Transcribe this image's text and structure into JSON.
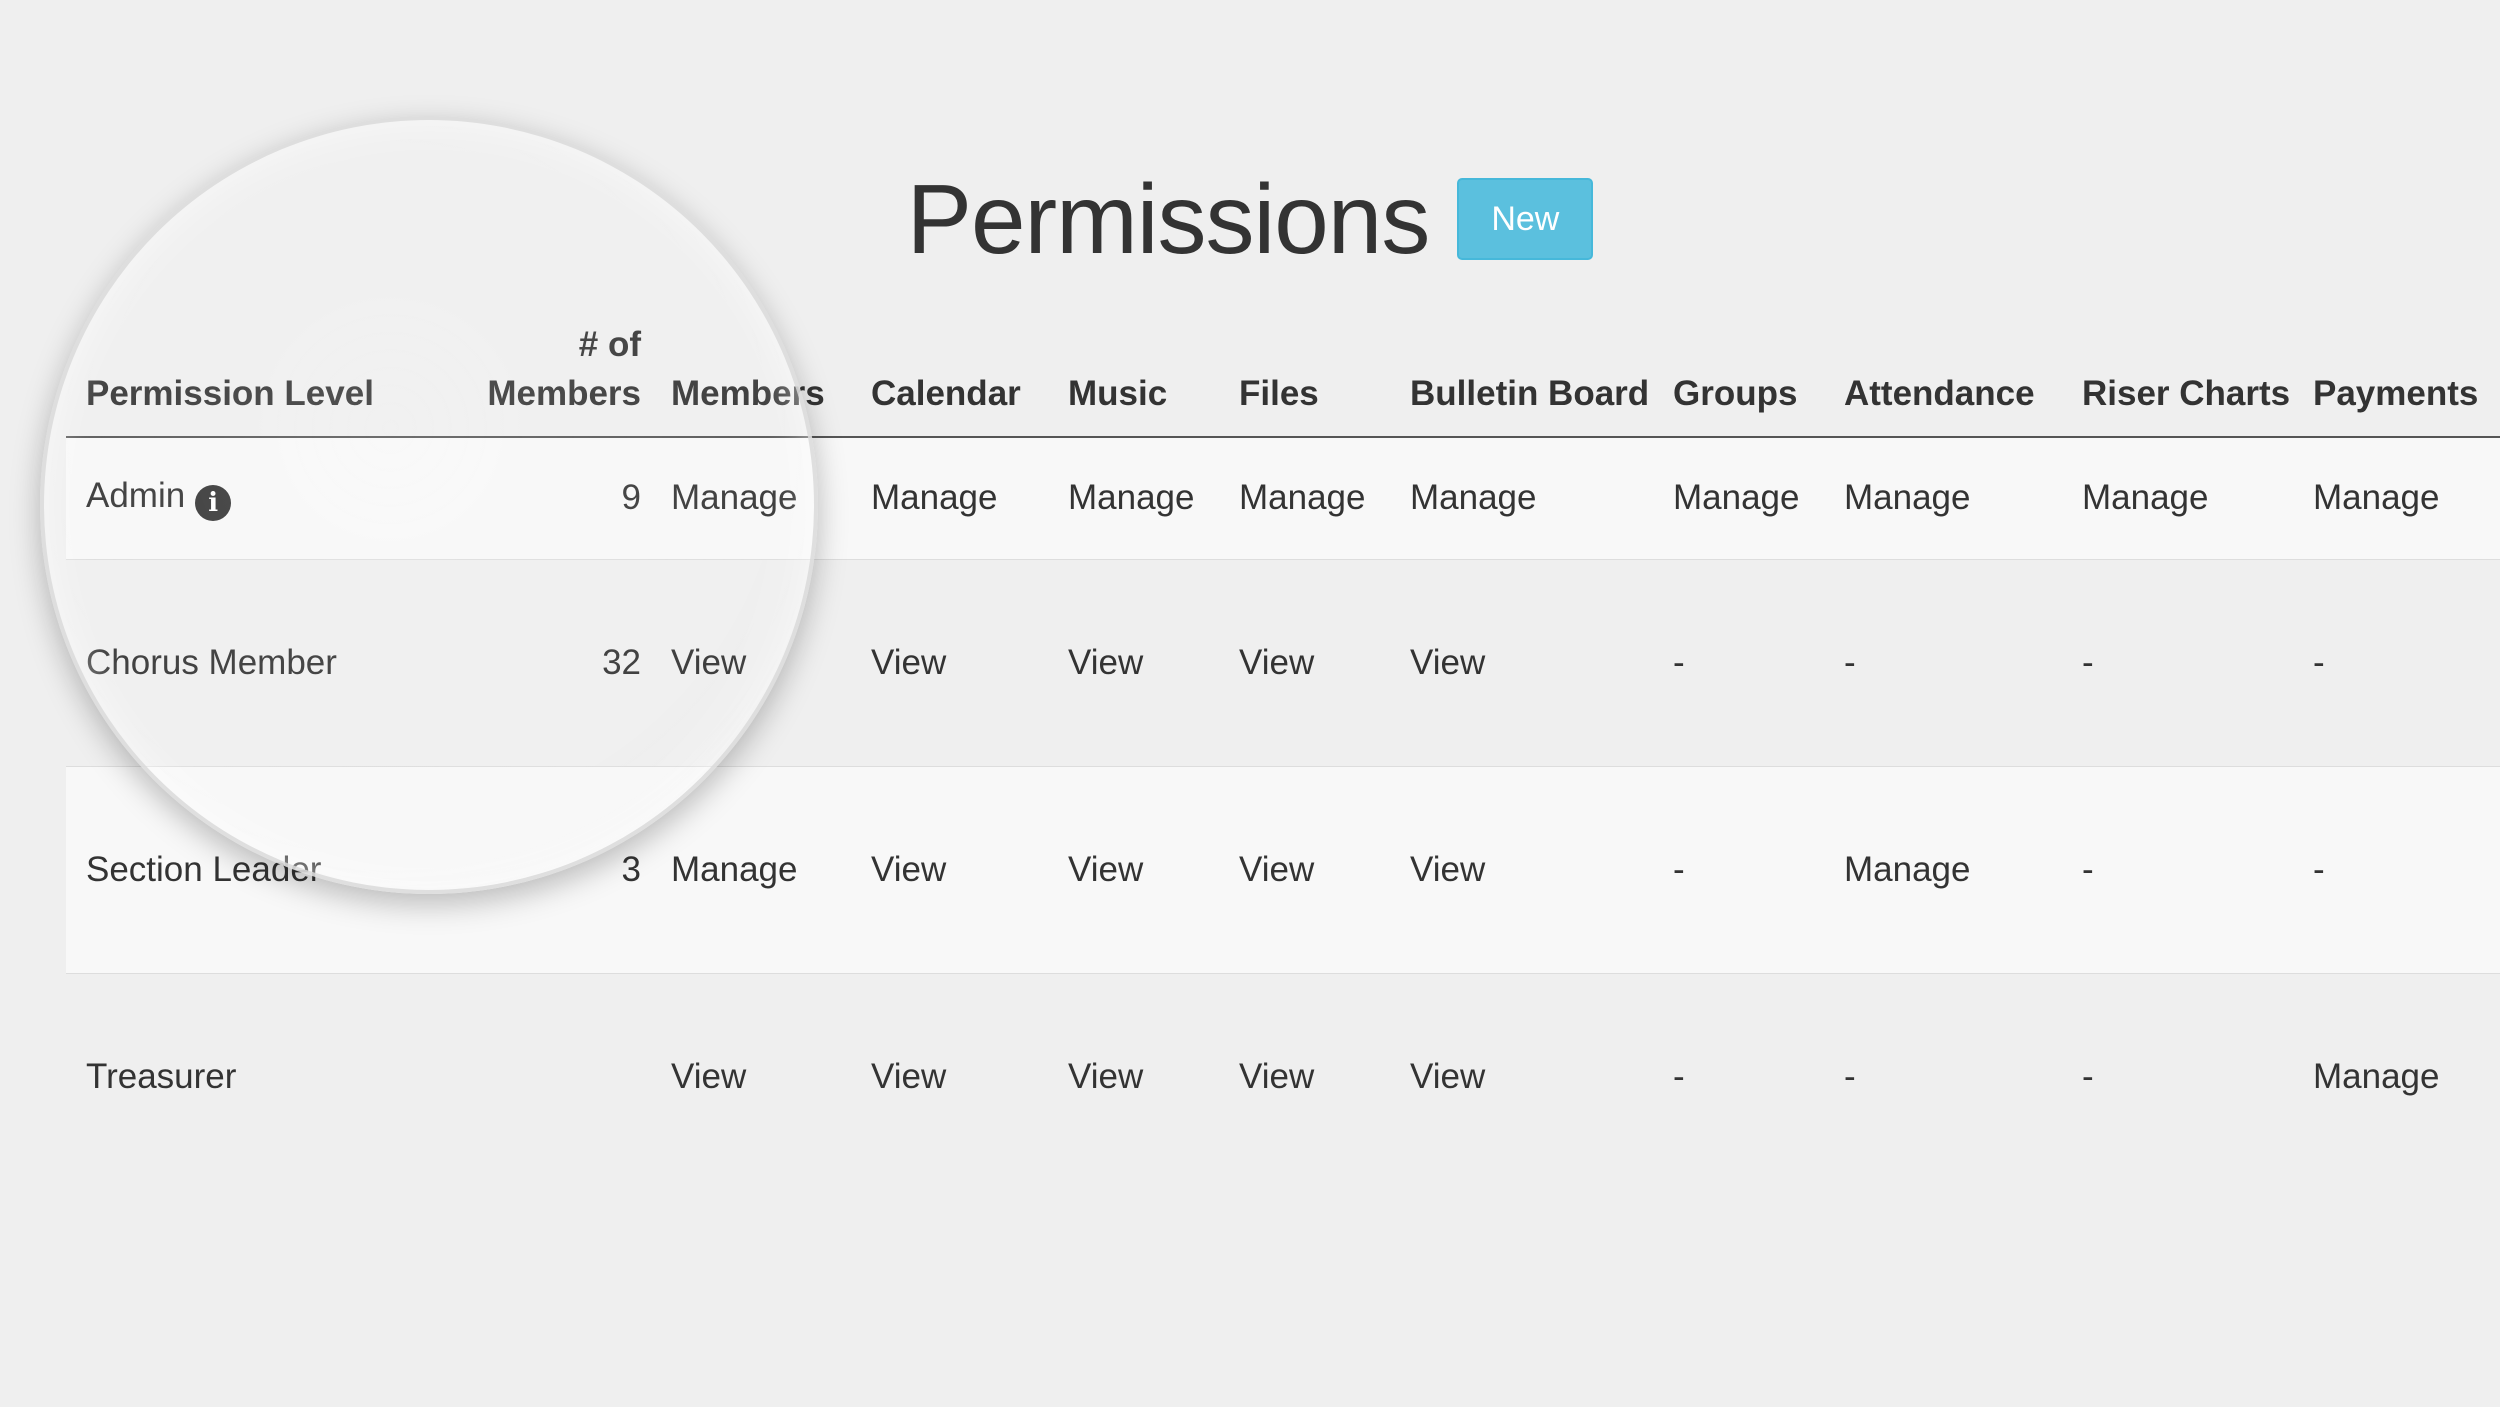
{
  "page": {
    "title": "Permissions",
    "new_button_label": "New"
  },
  "table": {
    "headers": [
      "Permission Level",
      "# of Members",
      "Members",
      "Calendar",
      "Music",
      "Files",
      "Bulletin Board",
      "Groups",
      "Attendance",
      "Riser Charts",
      "Payments"
    ],
    "rows": [
      {
        "name": "Admin",
        "has_info": true,
        "count": "9",
        "cells": [
          "Manage",
          "Manage",
          "Manage",
          "Manage",
          "Manage",
          "Manage",
          "Manage",
          "Manage",
          "Manage"
        ]
      },
      {
        "name": "Chorus Member",
        "has_info": false,
        "count": "32",
        "cells": [
          "View",
          "View",
          "View",
          "View",
          "View",
          "-",
          "-",
          "-",
          "-"
        ]
      },
      {
        "name": "Section Leader",
        "has_info": false,
        "count": "3",
        "cells": [
          "Manage",
          "View",
          "View",
          "View",
          "View",
          "-",
          "Manage",
          "-",
          "-"
        ]
      },
      {
        "name": "Treasurer",
        "has_info": false,
        "count": "",
        "cells": [
          "View",
          "View",
          "View",
          "View",
          "View",
          "-",
          "-",
          "-",
          "Manage"
        ]
      }
    ]
  },
  "icons": {
    "info": "info-circle-icon"
  },
  "colors": {
    "accent": "#5bc0de",
    "background": "#efefef"
  }
}
